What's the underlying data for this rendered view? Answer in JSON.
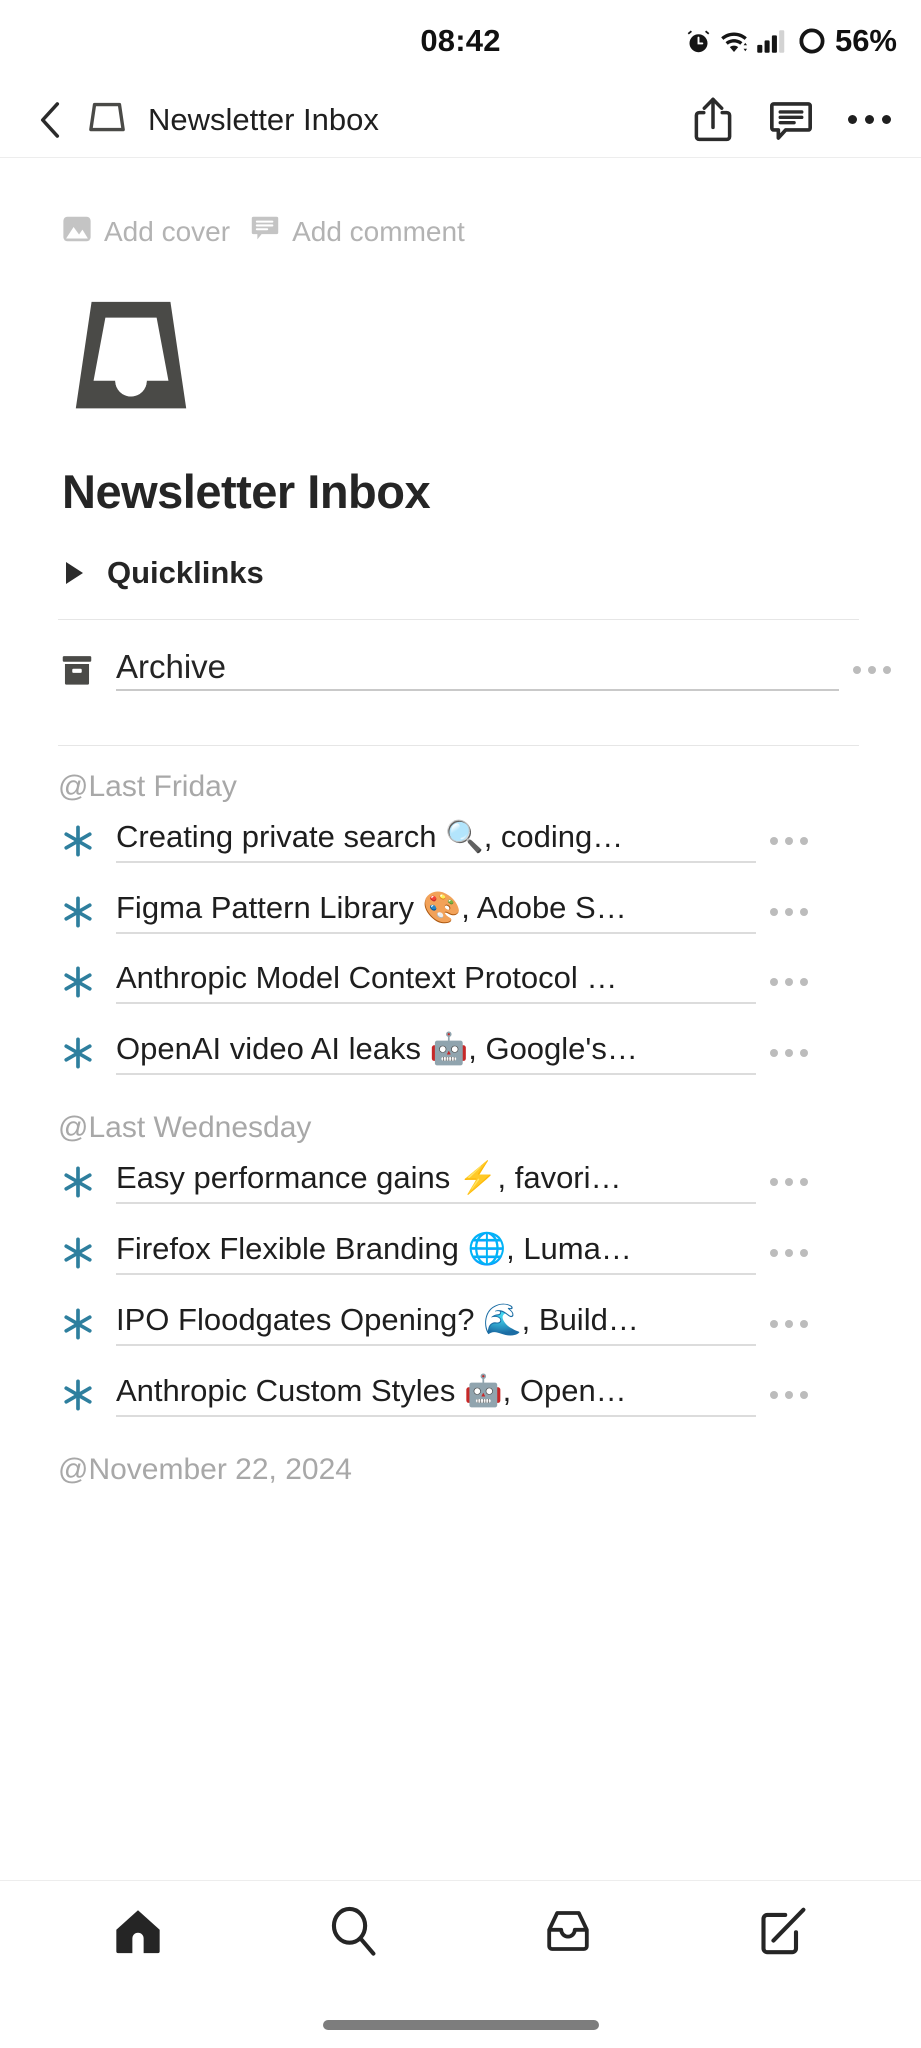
{
  "status_bar": {
    "time": "08:42",
    "battery_percent": "56%",
    "icons": [
      "alarm-icon",
      "wifi-icon",
      "signal-icon",
      "battery-icon"
    ]
  },
  "header": {
    "back_icon": "chevron-left-icon",
    "page_icon": "inbox-tray-icon",
    "title": "Newsletter Inbox",
    "actions": [
      {
        "name": "share-button",
        "icon": "share-icon"
      },
      {
        "name": "comment-button",
        "icon": "comment-icon"
      },
      {
        "name": "more-button",
        "icon": "more-horizontal-icon"
      }
    ]
  },
  "page": {
    "add_cover_label": "Add cover",
    "add_comment_label": "Add comment",
    "add_cover_icon": "image-icon",
    "add_comment_icon": "comment-bubble-icon",
    "icon": "inbox-tray-icon",
    "title": "Newsletter Inbox",
    "toggle": {
      "label": "Quicklinks",
      "expanded": false,
      "icon": "triangle-right-icon"
    },
    "archive": {
      "label": "Archive",
      "icon": "archive-box-icon",
      "menu_icon": "more-horizontal-icon"
    },
    "groups": [
      {
        "date": "@Last Friday",
        "entries": [
          {
            "icon": "asterisk-icon",
            "text": "Creating private search 🔍, coding…"
          },
          {
            "icon": "asterisk-icon",
            "text": "Figma Pattern Library 🎨, Adobe S…"
          },
          {
            "icon": "asterisk-icon",
            "text": "Anthropic Model Context Protocol …"
          },
          {
            "icon": "asterisk-icon",
            "text": "OpenAI video AI leaks 🤖, Google's…"
          }
        ]
      },
      {
        "date": "@Last Wednesday",
        "entries": [
          {
            "icon": "asterisk-icon",
            "text": "Easy performance gains ⚡, favori…"
          },
          {
            "icon": "asterisk-icon",
            "text": "Firefox Flexible Branding 🌐, Luma…"
          },
          {
            "icon": "asterisk-icon",
            "text": "IPO Floodgates Opening? 🌊, Build…"
          },
          {
            "icon": "asterisk-icon",
            "text": "Anthropic Custom Styles 🤖, Open…"
          }
        ]
      },
      {
        "date": "@November 22, 2024",
        "entries": []
      }
    ]
  },
  "bottom_nav": [
    {
      "name": "nav-home",
      "icon": "home-icon",
      "active": true
    },
    {
      "name": "nav-search",
      "icon": "search-icon",
      "active": false
    },
    {
      "name": "nav-inbox",
      "icon": "inbox-icon",
      "active": false
    },
    {
      "name": "nav-compose",
      "icon": "compose-icon",
      "active": false
    }
  ],
  "colors": {
    "accent_asterisk": "#2e7f9e",
    "text_primary": "#1e1e1e",
    "text_muted": "#a8a8a8",
    "icon_dark": "#4a4a47"
  }
}
